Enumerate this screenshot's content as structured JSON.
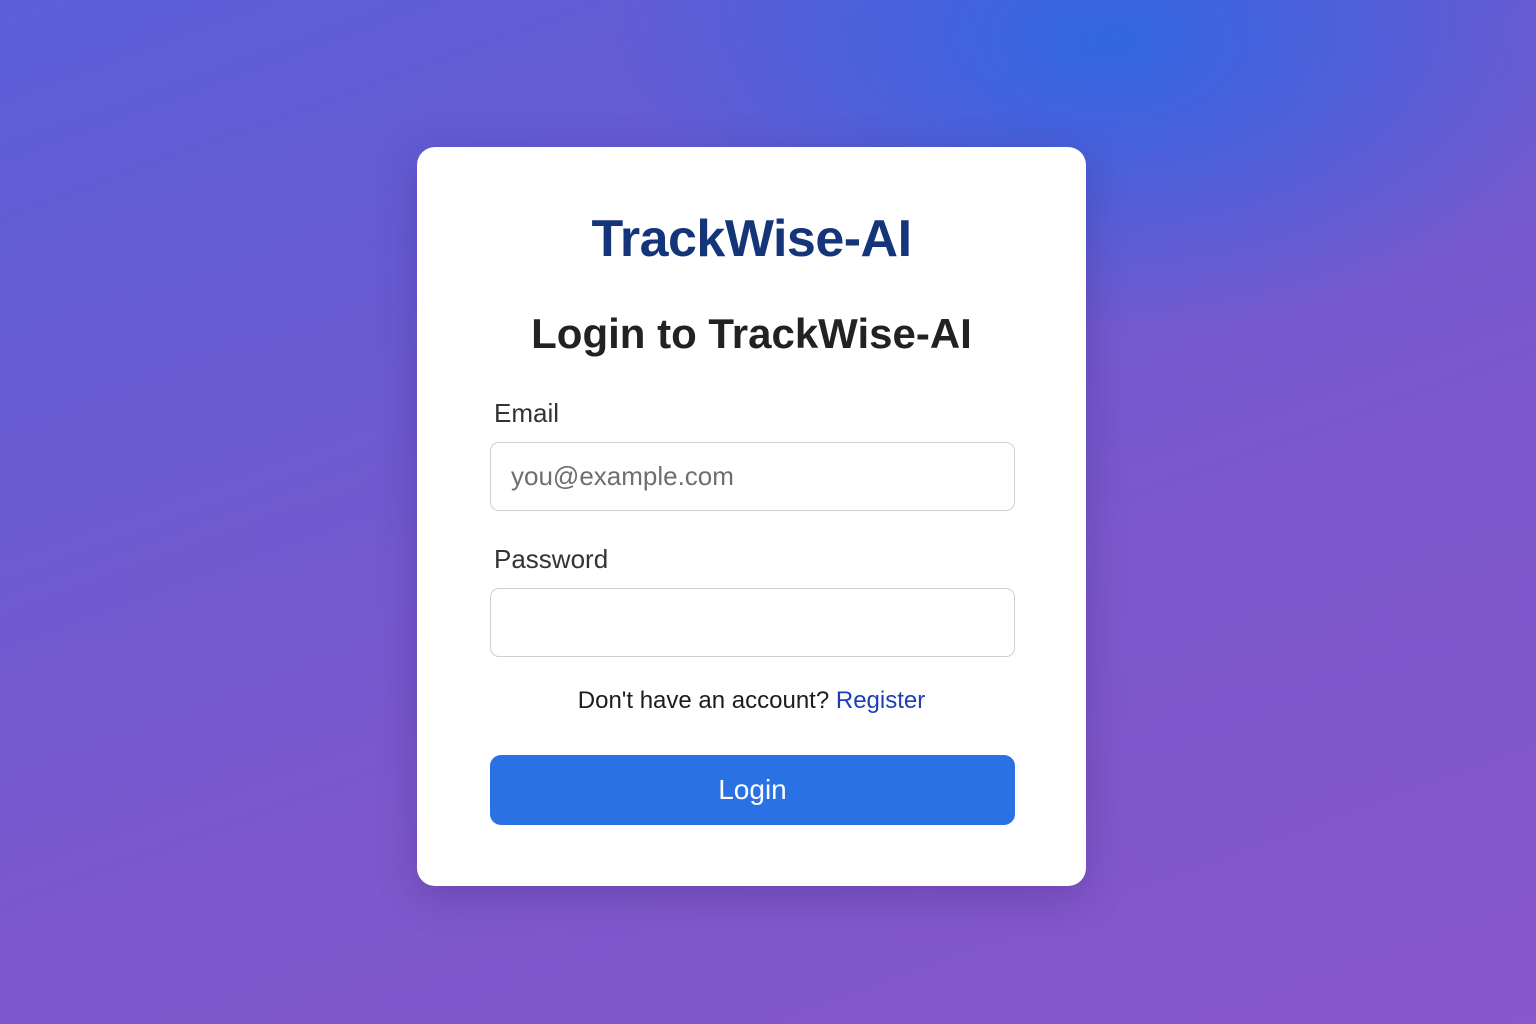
{
  "brand": {
    "name": "TrackWise-AI"
  },
  "form": {
    "heading": "Login to TrackWise-AI",
    "email": {
      "label": "Email",
      "placeholder": "you@example.com",
      "value": ""
    },
    "password": {
      "label": "Password",
      "placeholder": "",
      "value": ""
    },
    "register_prompt": "Don't have an account?",
    "register_link": "Register",
    "submit_label": "Login"
  },
  "colors": {
    "brand_text": "#15357a",
    "primary_button": "#2a71e4",
    "link": "#1c3fb8",
    "background_start": "#5a5fd8",
    "background_end": "#8956cb"
  }
}
